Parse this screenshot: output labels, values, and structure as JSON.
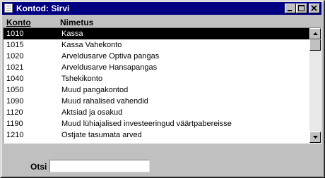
{
  "window": {
    "title": "Kontod: Sirvi"
  },
  "header": {
    "konto": "Konto",
    "nimetus": "Nimetus"
  },
  "rows": [
    {
      "code": "1010",
      "name": "Kassa",
      "selected": true
    },
    {
      "code": "1015",
      "name": "Kassa Vahekonto"
    },
    {
      "code": "1020",
      "name": "Arveldusarve Optiva pangas"
    },
    {
      "code": "1021",
      "name": "Arveldusarve Hansapangas"
    },
    {
      "code": "1040",
      "name": "Tshekikonto"
    },
    {
      "code": "1050",
      "name": "Muud pangakontod"
    },
    {
      "code": "1090",
      "name": "Muud rahalised vahendid"
    },
    {
      "code": "1120",
      "name": "Aktsiad ja osakud"
    },
    {
      "code": "1190",
      "name": "Muud lühiajalised investeeringud väärtpabereisse"
    },
    {
      "code": "1210",
      "name": "Ostjate tasumata arved"
    }
  ],
  "search": {
    "label": "Otsi",
    "value": ""
  },
  "icons": {
    "window": "document-icon",
    "minimize": "minimize-icon",
    "maximize": "maximize-icon",
    "close": "close-icon",
    "scroll_up": "arrow-up-icon",
    "scroll_down": "arrow-down-icon"
  }
}
